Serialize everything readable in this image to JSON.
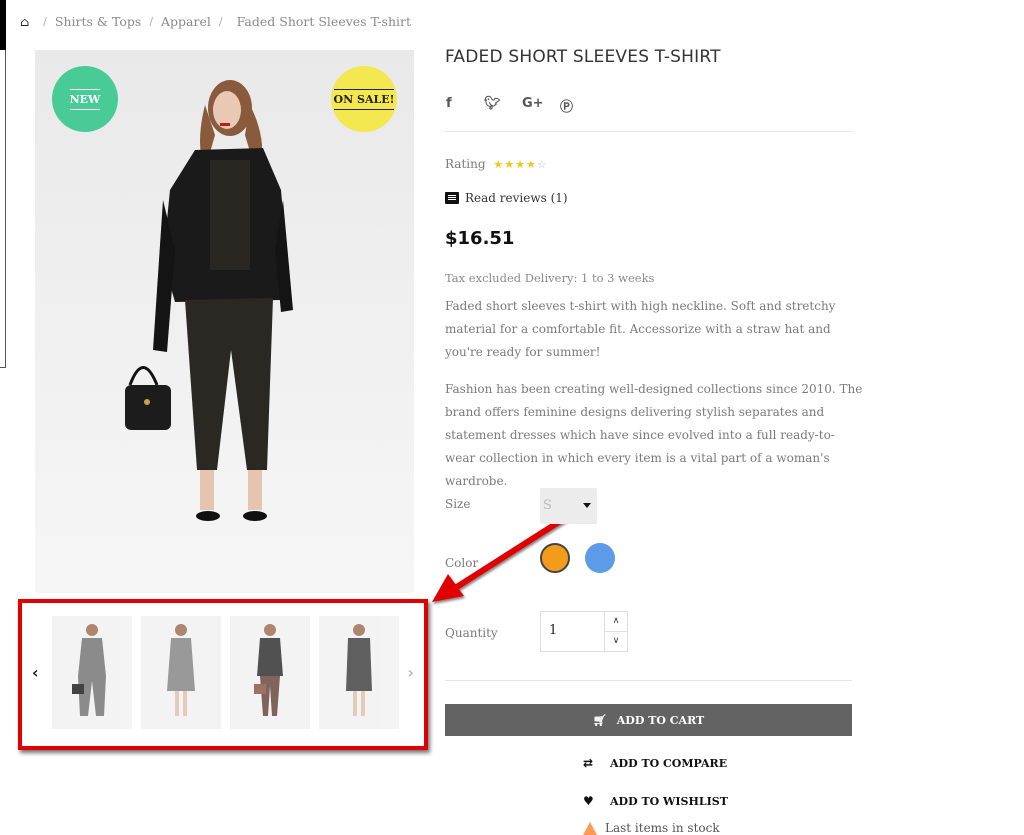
{
  "breadcrumb": {
    "home_icon": "home-icon",
    "items": [
      "Shirts & Tops",
      "Apparel",
      "Faded Short Sleeves T-shirt"
    ],
    "separator": "/"
  },
  "product": {
    "title": "FADED SHORT SLEEVES T-SHIRT",
    "badges": {
      "new": "NEW",
      "sale": "ON SALE!"
    },
    "social": [
      {
        "icon": "facebook-icon",
        "glyph": "f"
      },
      {
        "icon": "twitter-icon",
        "glyph": "t"
      },
      {
        "icon": "google-plus-icon",
        "glyph": "G+"
      },
      {
        "icon": "pinterest-icon",
        "glyph": "p"
      }
    ],
    "rating": {
      "label": "Rating",
      "value": 4,
      "max": 5
    },
    "reviews_link": "Read reviews (1)",
    "price": "$16.51",
    "tax_delivery": "Tax excluded Delivery: 1 to 3 weeks",
    "description": [
      "Faded short sleeves t-shirt with high neckline. Soft and stretchy material for a comfortable fit. Accessorize with a straw hat and you're ready for summer!",
      "Fashion has been creating well-designed collections since 2010. The brand offers feminine designs delivering stylish separates and statement dresses which have since evolved into a full ready-to-wear collection in which every item is a vital part of a woman's wardrobe."
    ],
    "size": {
      "label": "Size",
      "selected": "S"
    },
    "color": {
      "label": "Color",
      "options": [
        {
          "name": "Orange",
          "hex": "#f39c1b",
          "selected": true
        },
        {
          "name": "Blue",
          "hex": "#5b9be8",
          "selected": false
        }
      ]
    },
    "quantity": {
      "label": "Quantity",
      "value": "1"
    },
    "add_to_cart": "ADD TO CART",
    "add_to_compare": "ADD TO COMPARE",
    "add_to_wishlist": "ADD TO WISHLIST",
    "stock_status": "Last items in stock"
  },
  "thumbnails": {
    "count": 4,
    "prev_label": "‹",
    "next_label": "›"
  },
  "annotation": {
    "highlight_color": "#e00000",
    "target": "thumbnail carousel"
  }
}
